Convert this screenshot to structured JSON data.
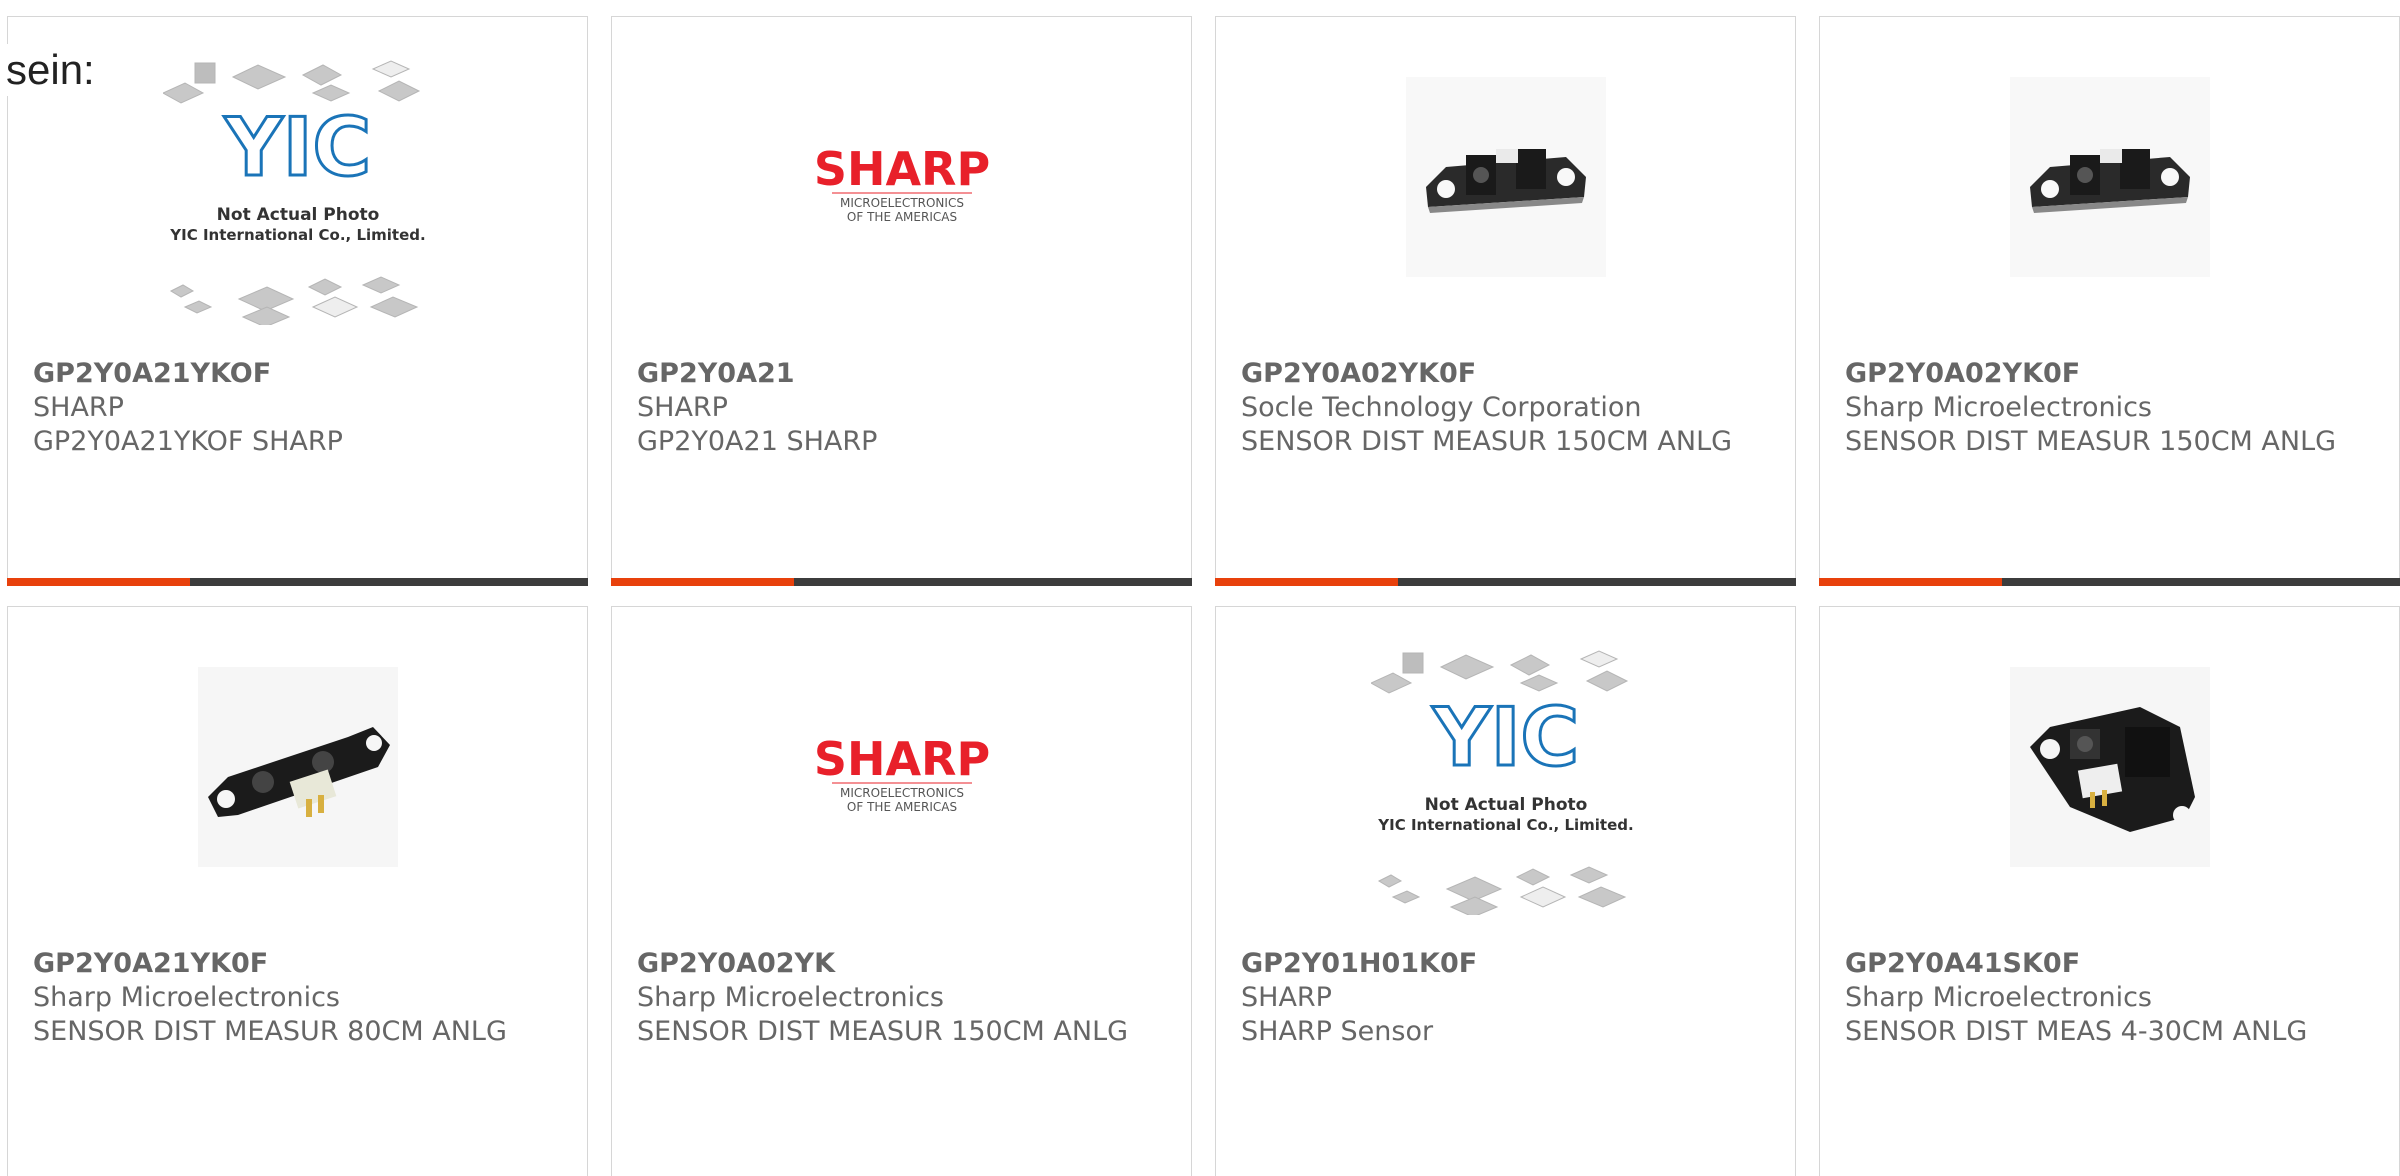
{
  "intro_text": "sein:",
  "accent_color": "#e8410c",
  "bar_color": "#3c3c3c",
  "logo": {
    "yic": {
      "mark": "YIC",
      "line1": "Not Actual Photo",
      "line2": "YIC International Co., Limited."
    },
    "sharp": {
      "brand": "SHARP",
      "line1": "MICROELECTRONICS",
      "line2": "OF THE AMERICAS"
    }
  },
  "products": [
    {
      "part": "GP2Y0A21YKOF",
      "maker": "SHARP",
      "desc": "GP2Y0A21YKOF SHARP",
      "image": "yic-placeholder"
    },
    {
      "part": "GP2Y0A21",
      "maker": "SHARP",
      "desc": "GP2Y0A21 SHARP",
      "image": "sharp-logo"
    },
    {
      "part": "GP2Y0A02YK0F",
      "maker": "Socle Technology Corporation",
      "desc": "SENSOR DIST MEASUR 150CM ANLG",
      "image": "ir-sensor-photo"
    },
    {
      "part": "GP2Y0A02YK0F",
      "maker": "Sharp Microelectronics",
      "desc": "SENSOR DIST MEASUR 150CM ANLG",
      "image": "ir-sensor-photo"
    },
    {
      "part": "GP2Y0A21YK0F",
      "maker": "Sharp Microelectronics",
      "desc": "SENSOR DIST MEASUR 80CM ANLG",
      "image": "ir-sensor-photo"
    },
    {
      "part": "GP2Y0A02YK",
      "maker": "Sharp Microelectronics",
      "desc": "SENSOR DIST MEASUR 150CM ANLG",
      "image": "sharp-logo"
    },
    {
      "part": "GP2Y01H01K0F",
      "maker": "SHARP",
      "desc": "SHARP Sensor",
      "image": "yic-placeholder"
    },
    {
      "part": "GP2Y0A41SK0F",
      "maker": "Sharp Microelectronics",
      "desc": "SENSOR DIST MEAS 4-30CM ANLG",
      "image": "ir-sensor-photo"
    }
  ]
}
